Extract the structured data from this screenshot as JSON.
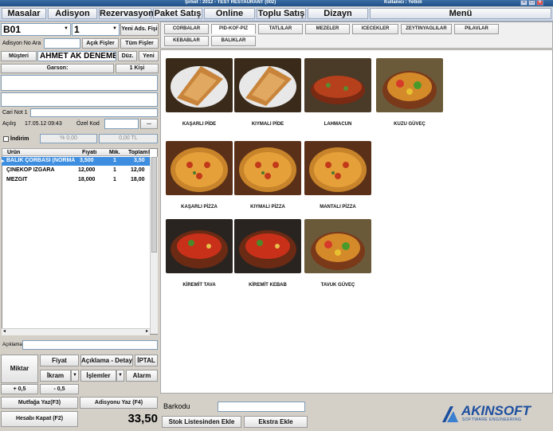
{
  "titlebar": {
    "company": "Şirket : 2012 - TEST RESTAURANT (002)",
    "user": "Kullanıcı : Yetkili"
  },
  "menu": [
    "Masalar",
    "Adisyon",
    "Rezervasyon",
    "Paket Satış",
    "Online",
    "Toplu Satış",
    "Dizayn",
    "Menü"
  ],
  "left": {
    "table_no": "B01",
    "guest_count": "1",
    "new_ads_button": "Yeni Ads. Fişi",
    "adisyon_no_label": "Adisyon No Ara",
    "acik_fisler": "Açık Fişler",
    "tum_fisler": "Tüm Fişler",
    "musteri_button": "Müşteri",
    "customer_name": "AHMET AK DENEME C",
    "duz_button": "Düz.",
    "yeni_button": "Yeni",
    "garson_button": "Garson:",
    "kisi_button": "1 Kişi",
    "cari_not_label": "Cari Not 1",
    "acilis_label": "Açılış",
    "acilis_value": "17.05.12 09:43",
    "ozel_kod_label": "Özel Kod",
    "ellipsis": "...",
    "indirim_label": "İndirim",
    "discount_pct": "% 0,00",
    "discount_tl": "0,00 TL",
    "columns": [
      "Ürün",
      "Fiyatı",
      "Mik.",
      "Toplam",
      "İ"
    ],
    "rows": [
      {
        "product": "BALIK ÇORBASI (NORMA",
        "price": "3,500",
        "qty": "1",
        "total": "3,50"
      },
      {
        "product": "ÇİNEKOP IZGARA",
        "price": "12,000",
        "qty": "1",
        "total": "12,00"
      },
      {
        "product": "MEZGİT",
        "price": "18,000",
        "qty": "1",
        "total": "18,00"
      }
    ],
    "aciklama_label": "Açıklama",
    "miktar": "Miktar",
    "fiyat": "Fiyat",
    "aciklama_detay": "Açıklama - Detay",
    "iptal": "İPTAL",
    "ikram": "İkram",
    "islemler": "İşlemler",
    "alarm": "Alarm",
    "plus": "+ 0,5",
    "minus": "- 0,5",
    "mutfaga": "Mutfağa Yaz(F3)",
    "adisyonu": "Adisyonu Yaz (F4)",
    "hesabi": "Hesabı Kapat (F2)",
    "total": "33,50"
  },
  "categories": [
    "CORBALAR",
    "PID-KOF-PIZ",
    "TATLILAR",
    "MEZELER",
    "ICECEKLER",
    "ZEYTINYAGLILAR",
    "PILAVLAR",
    "KEBABLAR",
    "BALIKLAR"
  ],
  "active_category": "PID-KOF-PIZ",
  "products": [
    {
      "name": "KAŞARLI PİDE",
      "kind": "pide"
    },
    {
      "name": "KIYMALI PİDE",
      "kind": "pide"
    },
    {
      "name": "LAHMACUN",
      "kind": "lahmacun"
    },
    {
      "name": "KUZU GÜVEÇ",
      "kind": "guvec"
    },
    {
      "name": "KAŞARLI PİZZA",
      "kind": "pizza"
    },
    {
      "name": "KIYMALI PİZZA",
      "kind": "pizza"
    },
    {
      "name": "MANTALI PİZZA",
      "kind": "pizza"
    },
    {
      "name": "KİREMİT TAVA",
      "kind": "tava"
    },
    {
      "name": "KİREMİT KEBAB",
      "kind": "tava"
    },
    {
      "name": "TAVUK GÜVEÇ",
      "kind": "guvec"
    }
  ],
  "bottom": {
    "barkodu_label": "Barkodu",
    "stok_button": "Stok Listesinden Ekle",
    "ekstra_button": "Ekstra Ekle",
    "logo_name": "AKINSOFT",
    "logo_tagline": "SOFTWARE ENGINEERING"
  },
  "colors": {
    "accent": "#3d8ee0",
    "logo": "#1d4e9e"
  }
}
